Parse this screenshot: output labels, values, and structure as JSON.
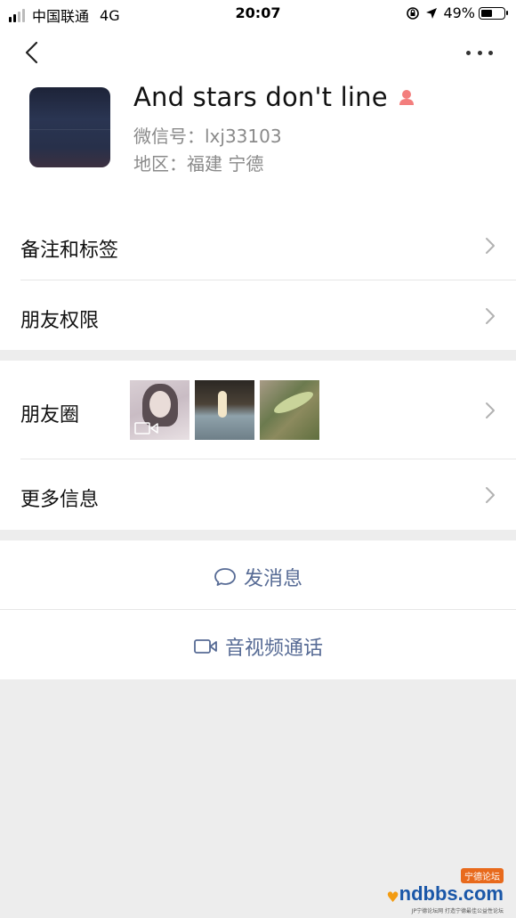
{
  "status_bar": {
    "carrier": "中国联通",
    "network": "4G",
    "time": "20:07",
    "battery": "49%",
    "battery_level": 0.49
  },
  "profile": {
    "nickname": "And stars don't line",
    "wechat_id": "微信号：lxj33103",
    "region": "地区：福建 宁德",
    "gender_icon": "female-icon",
    "gender_color": "#f37e7d"
  },
  "menu_group1": {
    "remark_tags_label": "备注和标签",
    "friend_permissions_label": "朋友权限"
  },
  "menu_group2": {
    "moments_label": "朋友圈",
    "more_info_label": "更多信息"
  },
  "actions": {
    "send_message_label": "发消息",
    "video_call_label": "音视频通话",
    "accent_color": "#576b95"
  },
  "watermark": {
    "logo_text": "ndbbs.com",
    "badge_text": "宁德论坛",
    "sub_text": "JP宁德论坛网 打造宁德最佳公益性论坛"
  }
}
